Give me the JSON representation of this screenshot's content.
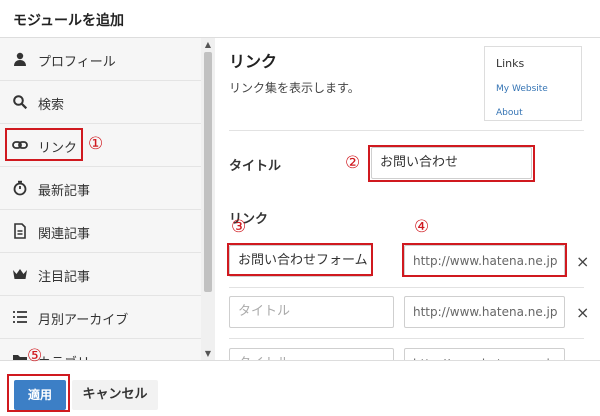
{
  "dialog": {
    "title": "モジュールを追加"
  },
  "sidebar": {
    "items": [
      {
        "label": "プロフィール",
        "icon": "user-icon"
      },
      {
        "label": "検索",
        "icon": "search-icon"
      },
      {
        "label": "リンク",
        "icon": "link-icon"
      },
      {
        "label": "最新記事",
        "icon": "stopwatch-icon"
      },
      {
        "label": "関連記事",
        "icon": "document-icon"
      },
      {
        "label": "注目記事",
        "icon": "crown-icon"
      },
      {
        "label": "月別アーカイブ",
        "icon": "list-icon"
      },
      {
        "label": "カテゴリー",
        "icon": "folder-icon"
      }
    ]
  },
  "main": {
    "title": "リンク",
    "description": "リンク集を表示します。",
    "preview": {
      "title": "Links",
      "links": [
        "My Website",
        "About"
      ]
    },
    "title_label": "タイトル",
    "title_value": "お問い合わせ",
    "links_label": "リンク",
    "rows": [
      {
        "title": "お問い合わせフォーム",
        "url": "http://www.hatena.ne.jp",
        "title_placeholder": "",
        "url_placeholder": ""
      },
      {
        "title": "",
        "url": "",
        "title_placeholder": "タイトル",
        "url_placeholder": "http://www.hatena.ne.jp"
      },
      {
        "title": "",
        "url": "",
        "title_placeholder": "タイトル",
        "url_placeholder": "http://www.hatena.ne.jp"
      }
    ],
    "remove_glyph": "×"
  },
  "footer": {
    "apply_label": "適用",
    "cancel_label": "キャンセル"
  },
  "annotations": [
    "①",
    "②",
    "③",
    "④",
    "⑤"
  ],
  "colors": {
    "accent": "#3c7fc6",
    "highlight": "#d0191f"
  }
}
